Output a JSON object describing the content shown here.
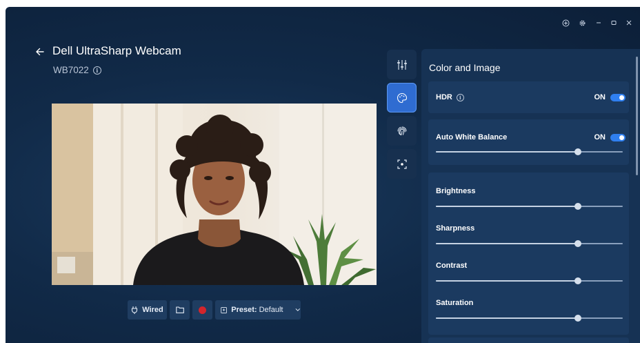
{
  "window": {
    "controls": [
      {
        "name": "add-icon"
      },
      {
        "name": "gear-icon"
      },
      {
        "name": "minimize-icon"
      },
      {
        "name": "maximize-icon"
      },
      {
        "name": "close-icon"
      }
    ]
  },
  "header": {
    "title": "Dell UltraSharp Webcam",
    "model": "WB7022"
  },
  "toolbar": {
    "connection_label": "Wired",
    "preset_prefix": "Preset:",
    "preset_value": "Default",
    "record_color": "#d3252c"
  },
  "rail": {
    "tabs": [
      {
        "name": "tab-adjustments",
        "icon": "sliders-icon",
        "active": false
      },
      {
        "name": "tab-color-and-image",
        "icon": "palette-icon",
        "active": true
      },
      {
        "name": "tab-privacy",
        "icon": "fingerprint-icon",
        "active": false
      },
      {
        "name": "tab-framing",
        "icon": "focus-frame-icon",
        "active": false
      }
    ]
  },
  "panel": {
    "title": "Color and Image",
    "hdr": {
      "label": "HDR",
      "state": "ON"
    },
    "auto_white_balance": {
      "label": "Auto White Balance",
      "state": "ON",
      "level": 0.76
    },
    "sliders": [
      {
        "label": "Brightness",
        "level": 0.76
      },
      {
        "label": "Sharpness",
        "level": 0.76
      },
      {
        "label": "Contrast",
        "level": 0.76
      },
      {
        "label": "Saturation",
        "level": 0.76
      }
    ]
  },
  "colors": {
    "accent": "#2f7ff0",
    "background": "#112a48",
    "panel": "#163254"
  }
}
